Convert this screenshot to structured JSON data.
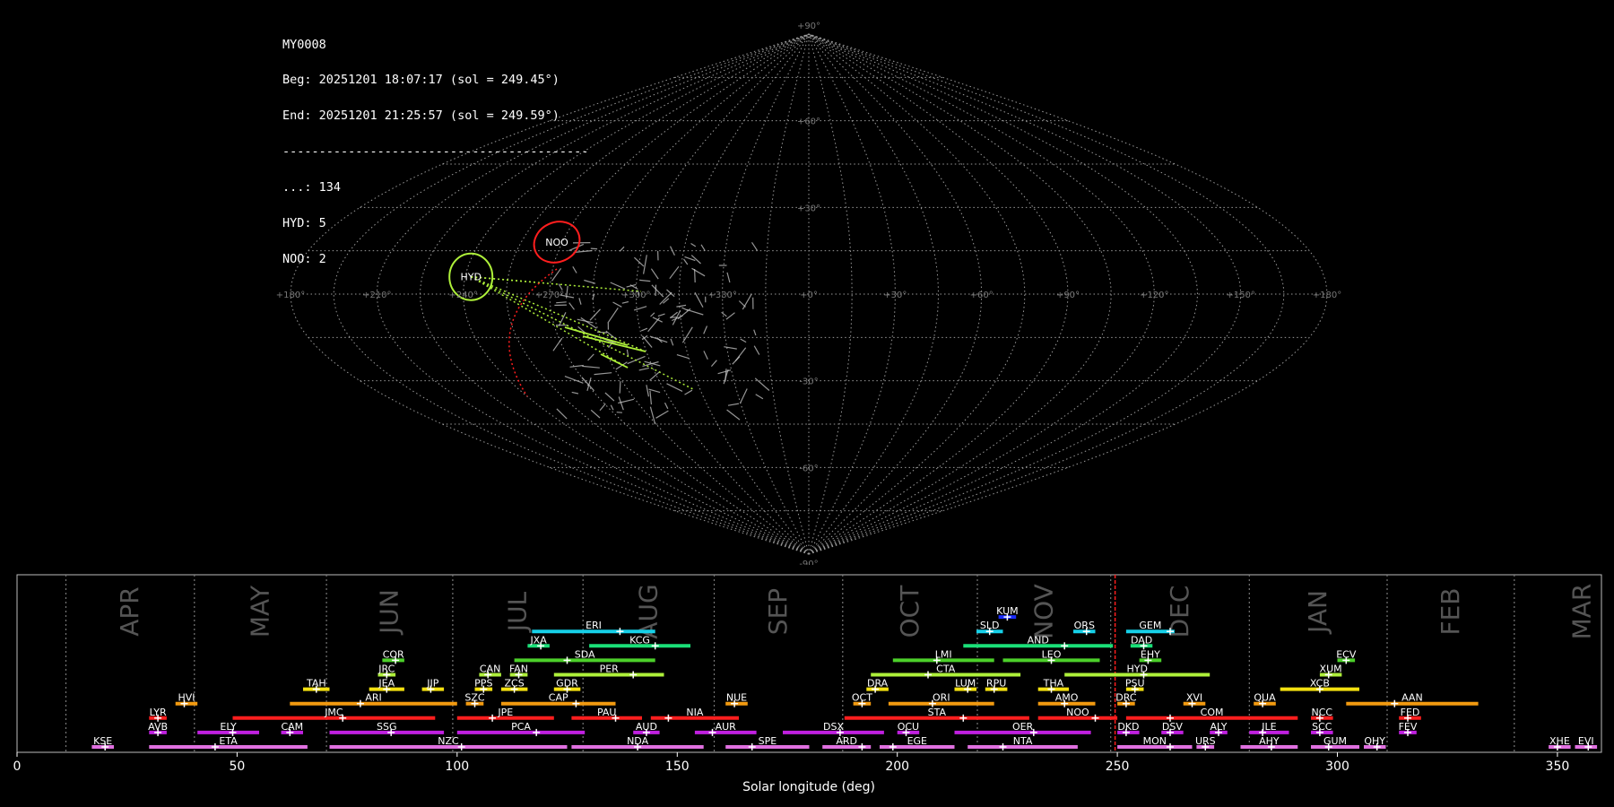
{
  "info": {
    "camera": "MY0008",
    "begin": "Beg: 20251201 18:07:17 (sol = 249.45°)",
    "end": "End: 20251201 21:25:57 (sol = 249.59°)",
    "separator": "------------------------------------------",
    "counts": [
      {
        "label": "...: 134"
      },
      {
        "label": "HYD: 5"
      },
      {
        "label": "NOO: 2"
      }
    ]
  },
  "colors": {
    "grid": "#9a9a9a",
    "HYD": "#aef03a",
    "NOO": "#ff1e1e",
    "sporadic": "#c8c8c8",
    "current_sol": "#ff1e1e"
  },
  "sky_map": {
    "projection": "sinusoidal",
    "lon_labels": [
      "+180°",
      "+150°",
      "+120°",
      "+90°",
      "+60°",
      "+30°",
      "+0°",
      "+330°",
      "+300°",
      "+270°",
      "+240°",
      "+210°",
      "+180°"
    ],
    "lat_labels": [
      "+90°",
      "+60°",
      "+30°",
      "-30°",
      "-60°",
      "-90°"
    ],
    "radiants": [
      {
        "code": "HYD",
        "lon": 118,
        "lat": 6
      },
      {
        "code": "NOO",
        "lon": 92,
        "lat": 18
      }
    ]
  },
  "chart_data": {
    "type": "bar",
    "title": "",
    "xlabel": "Solar longitude (deg)",
    "ylabel": "",
    "xlim": [
      0,
      360
    ],
    "x_ticks": [
      "0",
      "50",
      "100",
      "150",
      "200",
      "250",
      "300",
      "350"
    ],
    "current_sol": 249.5,
    "months": [
      {
        "name": "APR",
        "start": 11.1
      },
      {
        "name": "MAY",
        "start": 40.3
      },
      {
        "name": "JUN",
        "start": 70.3
      },
      {
        "name": "JUL",
        "start": 99.0
      },
      {
        "name": "AUG",
        "start": 128.6
      },
      {
        "name": "SEP",
        "start": 158.4
      },
      {
        "name": "OCT",
        "start": 187.6
      },
      {
        "name": "NOV",
        "start": 218.2
      },
      {
        "name": "DEC",
        "start": 248.5
      },
      {
        "name": "JAN",
        "start": 280.0
      },
      {
        "name": "FEB",
        "start": 311.3
      },
      {
        "name": "MAR",
        "start": 340.2
      }
    ],
    "showers": [
      {
        "code": "KUM",
        "start": 223,
        "end": 227,
        "peak": 225,
        "row": 9,
        "color": "#1a2bff"
      },
      {
        "code": "ERI",
        "start": 117,
        "end": 145,
        "peak": 137,
        "row": 8,
        "color": "#16d0e8"
      },
      {
        "code": "SLD",
        "start": 218,
        "end": 224,
        "peak": 221,
        "row": 8,
        "color": "#16d0e8"
      },
      {
        "code": "ORS",
        "start": 240,
        "end": 245,
        "peak": 243,
        "row": 8,
        "color": "#16d0e8"
      },
      {
        "code": "GEM",
        "start": 252,
        "end": 263,
        "peak": 262,
        "row": 8,
        "color": "#16d0e8"
      },
      {
        "code": "JXA",
        "start": 116,
        "end": 121,
        "peak": 119,
        "row": 7,
        "color": "#1ae078"
      },
      {
        "code": "KCG",
        "start": 130,
        "end": 153,
        "peak": 145,
        "row": 7,
        "color": "#1ae078"
      },
      {
        "code": "AND",
        "start": 215,
        "end": 249,
        "peak": 238,
        "row": 7,
        "color": "#1ae078"
      },
      {
        "code": "DAD",
        "start": 253,
        "end": 258,
        "peak": 256,
        "row": 7,
        "color": "#1ae078"
      },
      {
        "code": "COR",
        "start": 83,
        "end": 88,
        "peak": 86,
        "row": 6,
        "color": "#4cd02a"
      },
      {
        "code": "SDA",
        "start": 113,
        "end": 145,
        "peak": 125,
        "row": 6,
        "color": "#4cd02a"
      },
      {
        "code": "LMI",
        "start": 199,
        "end": 222,
        "peak": 209,
        "row": 6,
        "color": "#4cd02a"
      },
      {
        "code": "LEO",
        "start": 224,
        "end": 246,
        "peak": 235,
        "row": 6,
        "color": "#4cd02a"
      },
      {
        "code": "EHY",
        "start": 255,
        "end": 260,
        "peak": 257,
        "row": 6,
        "color": "#4cd02a"
      },
      {
        "code": "ECV",
        "start": 300,
        "end": 304,
        "peak": 302,
        "row": 6,
        "color": "#4cd02a"
      },
      {
        "code": "JRC",
        "start": 82,
        "end": 86,
        "peak": 84,
        "row": 5,
        "color": "#aef03a"
      },
      {
        "code": "CAN",
        "start": 105,
        "end": 110,
        "peak": 107,
        "row": 5,
        "color": "#aef03a"
      },
      {
        "code": "FAN",
        "start": 112,
        "end": 116,
        "peak": 114,
        "row": 5,
        "color": "#aef03a"
      },
      {
        "code": "PER",
        "start": 122,
        "end": 147,
        "peak": 140,
        "row": 5,
        "color": "#aef03a"
      },
      {
        "code": "CTA",
        "start": 194,
        "end": 228,
        "peak": 207,
        "row": 5,
        "color": "#aef03a"
      },
      {
        "code": "HYD",
        "start": 238,
        "end": 271,
        "peak": 256,
        "row": 5,
        "color": "#aef03a"
      },
      {
        "code": "XUM",
        "start": 296,
        "end": 301,
        "peak": 298,
        "row": 5,
        "color": "#aef03a"
      },
      {
        "code": "TAH",
        "start": 65,
        "end": 71,
        "peak": 68,
        "row": 4,
        "color": "#f2e010"
      },
      {
        "code": "JEA",
        "start": 80,
        "end": 88,
        "peak": 84,
        "row": 4,
        "color": "#f2e010"
      },
      {
        "code": "JIP",
        "start": 92,
        "end": 97,
        "peak": 94,
        "row": 4,
        "color": "#f2e010"
      },
      {
        "code": "PPS",
        "start": 104,
        "end": 108,
        "peak": 106,
        "row": 4,
        "color": "#f2e010"
      },
      {
        "code": "ZCS",
        "start": 110,
        "end": 116,
        "peak": 113,
        "row": 4,
        "color": "#f2e010"
      },
      {
        "code": "GDR",
        "start": 122,
        "end": 128,
        "peak": 125,
        "row": 4,
        "color": "#f2e010"
      },
      {
        "code": "DRA",
        "start": 193,
        "end": 198,
        "peak": 195,
        "row": 4,
        "color": "#f2e010"
      },
      {
        "code": "LUM",
        "start": 213,
        "end": 218,
        "peak": 216,
        "row": 4,
        "color": "#f2e010"
      },
      {
        "code": "RPU",
        "start": 220,
        "end": 225,
        "peak": 222,
        "row": 4,
        "color": "#f2e010"
      },
      {
        "code": "THA",
        "start": 232,
        "end": 239,
        "peak": 235,
        "row": 4,
        "color": "#f2e010"
      },
      {
        "code": "PSU",
        "start": 252,
        "end": 256,
        "peak": 254,
        "row": 4,
        "color": "#f2e010"
      },
      {
        "code": "XCB",
        "start": 287,
        "end": 305,
        "peak": 296,
        "row": 4,
        "color": "#f2e010"
      },
      {
        "code": "HVI",
        "start": 36,
        "end": 41,
        "peak": 38,
        "row": 3,
        "color": "#f29a10"
      },
      {
        "code": "ARI",
        "start": 62,
        "end": 100,
        "peak": 78,
        "row": 3,
        "color": "#f29a10"
      },
      {
        "code": "SZC",
        "start": 102,
        "end": 106,
        "peak": 104,
        "row": 3,
        "color": "#f29a10"
      },
      {
        "code": "CAP",
        "start": 110,
        "end": 136,
        "peak": 127,
        "row": 3,
        "color": "#f29a10"
      },
      {
        "code": "NUE",
        "start": 161,
        "end": 166,
        "peak": 163,
        "row": 3,
        "color": "#f29a10"
      },
      {
        "code": "OCT",
        "start": 190,
        "end": 194,
        "peak": 192,
        "row": 3,
        "color": "#f29a10"
      },
      {
        "code": "ORI",
        "start": 198,
        "end": 222,
        "peak": 208,
        "row": 3,
        "color": "#f29a10"
      },
      {
        "code": "AMO",
        "start": 232,
        "end": 245,
        "peak": 238,
        "row": 3,
        "color": "#f29a10"
      },
      {
        "code": "DRC",
        "start": 250,
        "end": 254,
        "peak": 252,
        "row": 3,
        "color": "#f29a10"
      },
      {
        "code": "XVI",
        "start": 265,
        "end": 270,
        "peak": 267,
        "row": 3,
        "color": "#f29a10"
      },
      {
        "code": "QUA",
        "start": 281,
        "end": 286,
        "peak": 283,
        "row": 3,
        "color": "#f29a10"
      },
      {
        "code": "AAN",
        "start": 302,
        "end": 332,
        "peak": 313,
        "row": 3,
        "color": "#f29a10"
      },
      {
        "code": "LYR",
        "start": 30,
        "end": 34,
        "peak": 32,
        "row": 2,
        "color": "#ff1e1e"
      },
      {
        "code": "JMC",
        "start": 49,
        "end": 95,
        "peak": 74,
        "row": 2,
        "color": "#ff1e1e"
      },
      {
        "code": "JPE",
        "start": 100,
        "end": 122,
        "peak": 108,
        "row": 2,
        "color": "#ff1e1e"
      },
      {
        "code": "PAU",
        "start": 126,
        "end": 142,
        "peak": 136,
        "row": 2,
        "color": "#ff1e1e"
      },
      {
        "code": "NIA",
        "start": 144,
        "end": 164,
        "peak": 148,
        "row": 2,
        "color": "#ff1e1e"
      },
      {
        "code": "STA",
        "start": 188,
        "end": 230,
        "peak": 215,
        "row": 2,
        "color": "#ff1e1e"
      },
      {
        "code": "NOO",
        "start": 232,
        "end": 250,
        "peak": 245,
        "row": 2,
        "color": "#ff1e1e"
      },
      {
        "code": "COM",
        "start": 252,
        "end": 291,
        "peak": 262,
        "row": 2,
        "color": "#ff1e1e"
      },
      {
        "code": "NCC",
        "start": 294,
        "end": 299,
        "peak": 296,
        "row": 2,
        "color": "#ff1e1e"
      },
      {
        "code": "FED",
        "start": 314,
        "end": 319,
        "peak": 316,
        "row": 2,
        "color": "#ff1e1e"
      },
      {
        "code": "AVB",
        "start": 30,
        "end": 34,
        "peak": 32,
        "row": 1,
        "color": "#c020e0"
      },
      {
        "code": "ELY",
        "start": 41,
        "end": 55,
        "peak": 49,
        "row": 1,
        "color": "#c020e0"
      },
      {
        "code": "CAM",
        "start": 60,
        "end": 65,
        "peak": 62,
        "row": 1,
        "color": "#c020e0"
      },
      {
        "code": "SSG",
        "start": 71,
        "end": 97,
        "peak": 85,
        "row": 1,
        "color": "#c020e0"
      },
      {
        "code": "PCA",
        "start": 100,
        "end": 129,
        "peak": 118,
        "row": 1,
        "color": "#c020e0"
      },
      {
        "code": "AUD",
        "start": 140,
        "end": 146,
        "peak": 143,
        "row": 1,
        "color": "#c020e0"
      },
      {
        "code": "AUR",
        "start": 154,
        "end": 168,
        "peak": 158,
        "row": 1,
        "color": "#c020e0"
      },
      {
        "code": "DSX",
        "start": 174,
        "end": 197,
        "peak": 187,
        "row": 1,
        "color": "#c020e0"
      },
      {
        "code": "OCU",
        "start": 200,
        "end": 205,
        "peak": 202,
        "row": 1,
        "color": "#c020e0"
      },
      {
        "code": "OER",
        "start": 213,
        "end": 244,
        "peak": 231,
        "row": 1,
        "color": "#c020e0"
      },
      {
        "code": "DKD",
        "start": 250,
        "end": 255,
        "peak": 252,
        "row": 1,
        "color": "#c020e0"
      },
      {
        "code": "DSV",
        "start": 260,
        "end": 265,
        "peak": 262,
        "row": 1,
        "color": "#c020e0"
      },
      {
        "code": "ALY",
        "start": 271,
        "end": 275,
        "peak": 273,
        "row": 1,
        "color": "#c020e0"
      },
      {
        "code": "JLE",
        "start": 280,
        "end": 289,
        "peak": 283,
        "row": 1,
        "color": "#c020e0"
      },
      {
        "code": "SCC",
        "start": 294,
        "end": 299,
        "peak": 296,
        "row": 1,
        "color": "#c020e0"
      },
      {
        "code": "FEV",
        "start": 314,
        "end": 318,
        "peak": 316,
        "row": 1,
        "color": "#c020e0"
      },
      {
        "code": "KSE",
        "start": 17,
        "end": 22,
        "peak": 20,
        "row": 0,
        "color": "#e070e0"
      },
      {
        "code": "ETA",
        "start": 30,
        "end": 66,
        "peak": 45,
        "row": 0,
        "color": "#e070e0"
      },
      {
        "code": "NZC",
        "start": 71,
        "end": 125,
        "peak": 101,
        "row": 0,
        "color": "#e070e0"
      },
      {
        "code": "NDA",
        "start": 126,
        "end": 156,
        "peak": 141,
        "row": 0,
        "color": "#e070e0"
      },
      {
        "code": "SPE",
        "start": 161,
        "end": 180,
        "peak": 167,
        "row": 0,
        "color": "#e070e0"
      },
      {
        "code": "ARD",
        "start": 183,
        "end": 194,
        "peak": 192,
        "row": 0,
        "color": "#e070e0"
      },
      {
        "code": "EGE",
        "start": 196,
        "end": 213,
        "peak": 199,
        "row": 0,
        "color": "#e070e0"
      },
      {
        "code": "NTA",
        "start": 216,
        "end": 241,
        "peak": 224,
        "row": 0,
        "color": "#e070e0"
      },
      {
        "code": "MON",
        "start": 250,
        "end": 267,
        "peak": 262,
        "row": 0,
        "color": "#e070e0"
      },
      {
        "code": "URS",
        "start": 268,
        "end": 272,
        "peak": 270,
        "row": 0,
        "color": "#e070e0"
      },
      {
        "code": "AHY",
        "start": 278,
        "end": 291,
        "peak": 285,
        "row": 0,
        "color": "#e070e0"
      },
      {
        "code": "GUM",
        "start": 294,
        "end": 305,
        "peak": 298,
        "row": 0,
        "color": "#e070e0"
      },
      {
        "code": "QHY",
        "start": 306,
        "end": 311,
        "peak": 309,
        "row": 0,
        "color": "#e070e0"
      },
      {
        "code": "XHE",
        "start": 348,
        "end": 353,
        "peak": 350,
        "row": 0,
        "color": "#e070e0"
      },
      {
        "code": "EVI",
        "start": 354,
        "end": 359,
        "peak": 357,
        "row": 0,
        "color": "#e070e0"
      }
    ]
  }
}
